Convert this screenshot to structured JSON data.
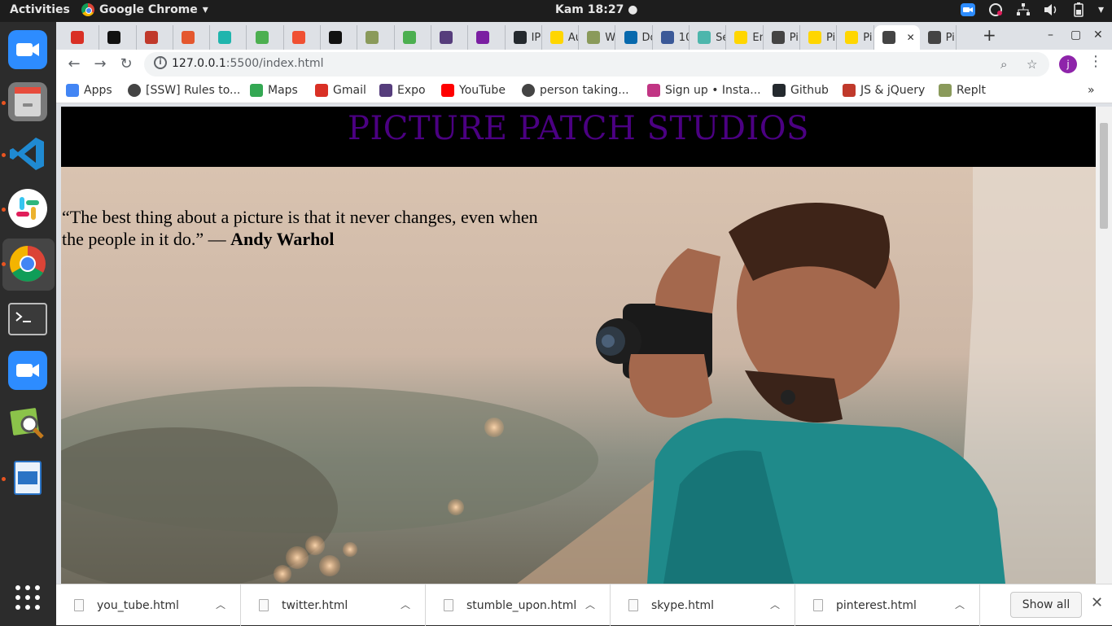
{
  "topbar": {
    "activities": "Activities",
    "app_name": "Google Chrome",
    "clock": "Kam 18:27"
  },
  "tabs": [
    {
      "icon": "gmail-icon",
      "title": "",
      "color": "#d93025"
    },
    {
      "icon": "hackernoon-icon",
      "title": "",
      "color": "#111111"
    },
    {
      "icon": "grid-icon",
      "title": "",
      "color": "#c0392b"
    },
    {
      "icon": "ask-icon",
      "title": "",
      "color": "#e4572e"
    },
    {
      "icon": "s-icon",
      "title": "",
      "color": "#1fb5ad"
    },
    {
      "icon": "w3-icon",
      "title": "",
      "color": "#4caf50"
    },
    {
      "icon": "git-icon",
      "title": "",
      "color": "#f05032"
    },
    {
      "icon": "medium-icon",
      "title": "",
      "color": "#111111"
    },
    {
      "icon": "tree-icon",
      "title": "",
      "color": "#8a9a5b"
    },
    {
      "icon": "w3-icon",
      "title": "",
      "color": "#4caf50"
    },
    {
      "icon": "bootstrap-icon",
      "title": "",
      "color": "#563d7c"
    },
    {
      "icon": "code-icon",
      "title": "",
      "color": "#7b1fa2"
    },
    {
      "icon": "github-icon",
      "title": "IP",
      "color": "#24292e"
    },
    {
      "icon": "codecademy-icon",
      "title": "Au",
      "color": "#ffd600"
    },
    {
      "icon": "tree-icon",
      "title": "W",
      "color": "#8a9a5b"
    },
    {
      "icon": "jquery-icon",
      "title": "Do",
      "color": "#0769ad"
    },
    {
      "icon": "bo-icon",
      "title": "10",
      "color": "#3b5998"
    },
    {
      "icon": "se-icon",
      "title": "Se",
      "color": "#4db6ac"
    },
    {
      "icon": "codecademy-icon",
      "title": "En",
      "color": "#ffd600"
    },
    {
      "icon": "globe-icon",
      "title": "Pi",
      "color": "#444444"
    },
    {
      "icon": "codecademy-icon",
      "title": "Pi",
      "color": "#ffd600"
    },
    {
      "icon": "codecademy-icon",
      "title": "Pi",
      "color": "#ffd600"
    },
    {
      "icon": "globe-icon",
      "title": "",
      "color": "#444444"
    },
    {
      "icon": "globe-icon",
      "title": "Pi",
      "color": "#444444"
    }
  ],
  "address_bar": {
    "host": "127.0.0.1",
    "path": ":5500/index.html"
  },
  "profile_initial": "j",
  "bookmarks": [
    {
      "icon": "apps-icon",
      "label": "Apps"
    },
    {
      "icon": "globe-icon",
      "label": "[SSW] Rules to..."
    },
    {
      "icon": "maps-icon",
      "label": "Maps"
    },
    {
      "icon": "gmail-icon",
      "label": "Gmail"
    },
    {
      "icon": "expo-icon",
      "label": "Expo"
    },
    {
      "icon": "youtube-icon",
      "label": "YouTube"
    },
    {
      "icon": "globe-icon",
      "label": "person taking..."
    },
    {
      "icon": "instagram-icon",
      "label": "Sign up • Insta..."
    },
    {
      "icon": "github-icon",
      "label": "Github"
    },
    {
      "icon": "grid-icon",
      "label": "JS & jQuery"
    },
    {
      "icon": "tree-icon",
      "label": "Replt"
    }
  ],
  "page": {
    "site_title": "PICTURE PATCH STUDIOS",
    "quote_text": "“The best thing about a picture is that it never changes, even when the people in it do.” — ",
    "quote_author": "Andy Warhol"
  },
  "downloads": [
    {
      "file": "you_tube.html"
    },
    {
      "file": "twitter.html"
    },
    {
      "file": "stumble_upon.html"
    },
    {
      "file": "skype.html"
    },
    {
      "file": "pinterest.html"
    }
  ],
  "downloads_show_all": "Show all"
}
